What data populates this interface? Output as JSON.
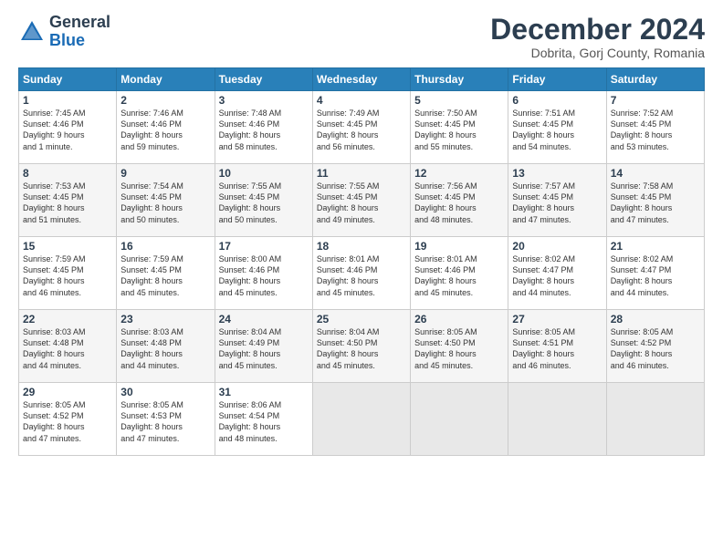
{
  "header": {
    "logo_general": "General",
    "logo_blue": "Blue",
    "month_title": "December 2024",
    "location": "Dobrita, Gorj County, Romania"
  },
  "days_of_week": [
    "Sunday",
    "Monday",
    "Tuesday",
    "Wednesday",
    "Thursday",
    "Friday",
    "Saturday"
  ],
  "weeks": [
    [
      {
        "day": "1",
        "info": "Sunrise: 7:45 AM\nSunset: 4:46 PM\nDaylight: 9 hours\nand 1 minute."
      },
      {
        "day": "2",
        "info": "Sunrise: 7:46 AM\nSunset: 4:46 PM\nDaylight: 8 hours\nand 59 minutes."
      },
      {
        "day": "3",
        "info": "Sunrise: 7:48 AM\nSunset: 4:46 PM\nDaylight: 8 hours\nand 58 minutes."
      },
      {
        "day": "4",
        "info": "Sunrise: 7:49 AM\nSunset: 4:45 PM\nDaylight: 8 hours\nand 56 minutes."
      },
      {
        "day": "5",
        "info": "Sunrise: 7:50 AM\nSunset: 4:45 PM\nDaylight: 8 hours\nand 55 minutes."
      },
      {
        "day": "6",
        "info": "Sunrise: 7:51 AM\nSunset: 4:45 PM\nDaylight: 8 hours\nand 54 minutes."
      },
      {
        "day": "7",
        "info": "Sunrise: 7:52 AM\nSunset: 4:45 PM\nDaylight: 8 hours\nand 53 minutes."
      }
    ],
    [
      {
        "day": "8",
        "info": "Sunrise: 7:53 AM\nSunset: 4:45 PM\nDaylight: 8 hours\nand 51 minutes."
      },
      {
        "day": "9",
        "info": "Sunrise: 7:54 AM\nSunset: 4:45 PM\nDaylight: 8 hours\nand 50 minutes."
      },
      {
        "day": "10",
        "info": "Sunrise: 7:55 AM\nSunset: 4:45 PM\nDaylight: 8 hours\nand 50 minutes."
      },
      {
        "day": "11",
        "info": "Sunrise: 7:55 AM\nSunset: 4:45 PM\nDaylight: 8 hours\nand 49 minutes."
      },
      {
        "day": "12",
        "info": "Sunrise: 7:56 AM\nSunset: 4:45 PM\nDaylight: 8 hours\nand 48 minutes."
      },
      {
        "day": "13",
        "info": "Sunrise: 7:57 AM\nSunset: 4:45 PM\nDaylight: 8 hours\nand 47 minutes."
      },
      {
        "day": "14",
        "info": "Sunrise: 7:58 AM\nSunset: 4:45 PM\nDaylight: 8 hours\nand 47 minutes."
      }
    ],
    [
      {
        "day": "15",
        "info": "Sunrise: 7:59 AM\nSunset: 4:45 PM\nDaylight: 8 hours\nand 46 minutes."
      },
      {
        "day": "16",
        "info": "Sunrise: 7:59 AM\nSunset: 4:45 PM\nDaylight: 8 hours\nand 45 minutes."
      },
      {
        "day": "17",
        "info": "Sunrise: 8:00 AM\nSunset: 4:46 PM\nDaylight: 8 hours\nand 45 minutes."
      },
      {
        "day": "18",
        "info": "Sunrise: 8:01 AM\nSunset: 4:46 PM\nDaylight: 8 hours\nand 45 minutes."
      },
      {
        "day": "19",
        "info": "Sunrise: 8:01 AM\nSunset: 4:46 PM\nDaylight: 8 hours\nand 45 minutes."
      },
      {
        "day": "20",
        "info": "Sunrise: 8:02 AM\nSunset: 4:47 PM\nDaylight: 8 hours\nand 44 minutes."
      },
      {
        "day": "21",
        "info": "Sunrise: 8:02 AM\nSunset: 4:47 PM\nDaylight: 8 hours\nand 44 minutes."
      }
    ],
    [
      {
        "day": "22",
        "info": "Sunrise: 8:03 AM\nSunset: 4:48 PM\nDaylight: 8 hours\nand 44 minutes."
      },
      {
        "day": "23",
        "info": "Sunrise: 8:03 AM\nSunset: 4:48 PM\nDaylight: 8 hours\nand 44 minutes."
      },
      {
        "day": "24",
        "info": "Sunrise: 8:04 AM\nSunset: 4:49 PM\nDaylight: 8 hours\nand 45 minutes."
      },
      {
        "day": "25",
        "info": "Sunrise: 8:04 AM\nSunset: 4:50 PM\nDaylight: 8 hours\nand 45 minutes."
      },
      {
        "day": "26",
        "info": "Sunrise: 8:05 AM\nSunset: 4:50 PM\nDaylight: 8 hours\nand 45 minutes."
      },
      {
        "day": "27",
        "info": "Sunrise: 8:05 AM\nSunset: 4:51 PM\nDaylight: 8 hours\nand 46 minutes."
      },
      {
        "day": "28",
        "info": "Sunrise: 8:05 AM\nSunset: 4:52 PM\nDaylight: 8 hours\nand 46 minutes."
      }
    ],
    [
      {
        "day": "29",
        "info": "Sunrise: 8:05 AM\nSunset: 4:52 PM\nDaylight: 8 hours\nand 47 minutes."
      },
      {
        "day": "30",
        "info": "Sunrise: 8:05 AM\nSunset: 4:53 PM\nDaylight: 8 hours\nand 47 minutes."
      },
      {
        "day": "31",
        "info": "Sunrise: 8:06 AM\nSunset: 4:54 PM\nDaylight: 8 hours\nand 48 minutes."
      },
      {
        "day": "",
        "info": ""
      },
      {
        "day": "",
        "info": ""
      },
      {
        "day": "",
        "info": ""
      },
      {
        "day": "",
        "info": ""
      }
    ]
  ]
}
